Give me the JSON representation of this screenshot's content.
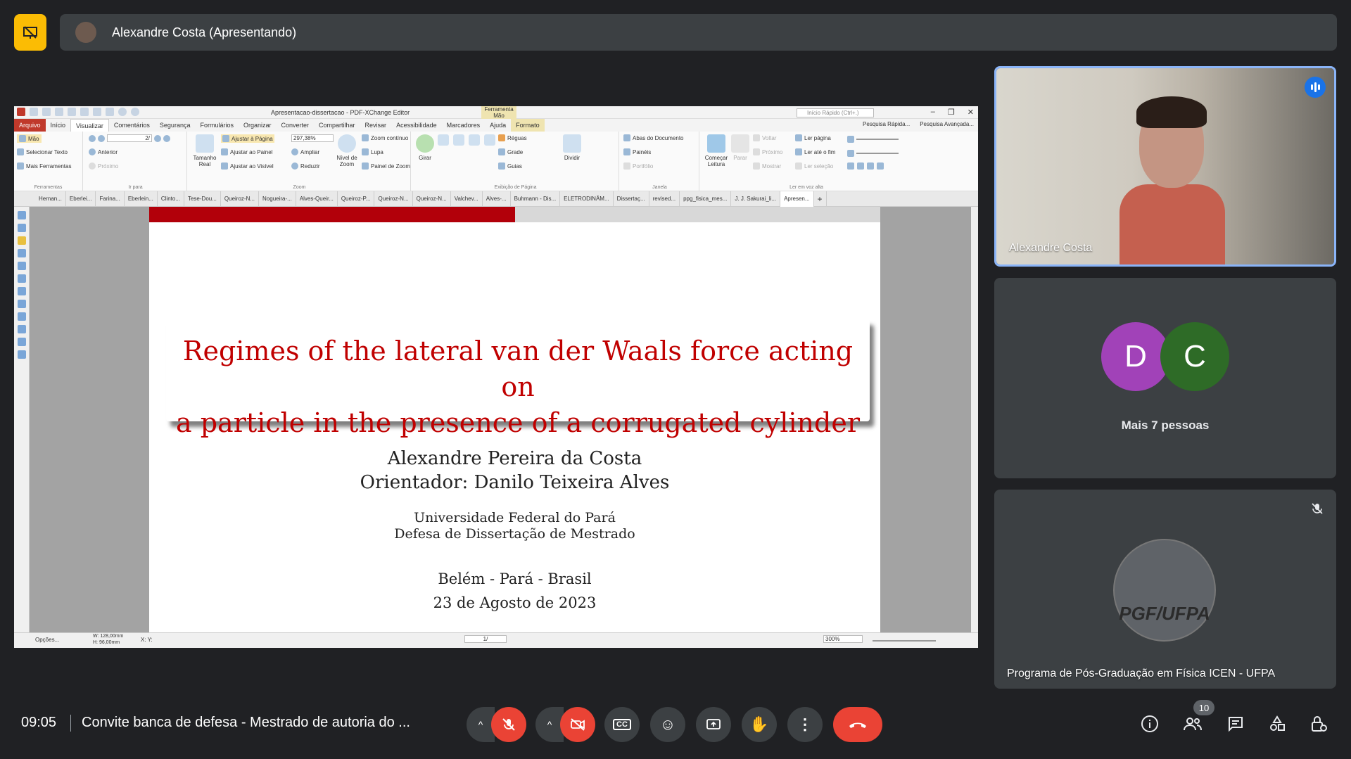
{
  "presenter": {
    "label": "Alexandre Costa (Apresentando)"
  },
  "pdf_app": {
    "window_title": "Apresentacao-dissertacao - PDF-XChange Editor",
    "quick_search_placeholder": "Início Rápido (Ctrl+.)",
    "context_tab": "Ferramenta Mão",
    "menu": [
      "Arquivo",
      "Início",
      "Visualizar",
      "Comentários",
      "Segurança",
      "Formulários",
      "Organizar",
      "Converter",
      "Compartilhar",
      "Revisar",
      "Acessibilidade",
      "Marcadores",
      "Ajuda",
      "Formato"
    ],
    "ribbon_right": [
      "Pesquisa Rápida...",
      "Pesquisa Avançada..."
    ],
    "ribbon_groups": {
      "ferramentas": {
        "label": "Ferramentas",
        "items": [
          "Mão",
          "Selecionar Texto",
          "Mais Ferramentas"
        ]
      },
      "ir_para": {
        "label": "Ir para",
        "page_field": "2/",
        "items": [
          "Anterior",
          "Próximo"
        ]
      },
      "zoom": {
        "label": "Zoom",
        "zoom_value": "297,38%",
        "big": "Tamanho Real",
        "items": [
          "Ajustar à Página",
          "Ajustar ao Painel",
          "Ajustar ao Visível",
          "Ampliar",
          "Reduzir"
        ],
        "nivel": "Nível de Zoom",
        "items2": [
          "Zoom contínuo",
          "Lupa",
          "Painel de Zoom"
        ]
      },
      "exibicao": {
        "label": "Exibição de Página",
        "girar": "Girar",
        "items": [
          "Réguas",
          "Grade",
          "Guias"
        ],
        "dividir": "Dividir"
      },
      "janela": {
        "label": "Janela",
        "items": [
          "Abas do Documento",
          "Painéis",
          "Portfólio"
        ]
      },
      "ler": {
        "label": "Ler em voz alta",
        "comecar": "Começar Leitura",
        "parar": "Parar",
        "items": [
          "Voltar",
          "Próximo",
          "Mostrar"
        ],
        "items2": [
          "Ler página",
          "Ler até o fim",
          "Ler seleção"
        ]
      }
    },
    "doc_tabs": [
      "Hernan...",
      "Eberlei...",
      "Farina...",
      "Eberlein...",
      "Clinto...",
      "Tese-Dou...",
      "Queiroz-N...",
      "Nogueira-...",
      "Alves-Queir...",
      "Queiroz-P...",
      "Queiroz-N...",
      "Queiroz-N...",
      "Valchev...",
      "Alves-...",
      "Buhmann - Dis...",
      "ELETRODINÂM...",
      "Dissertaç...",
      "revised...",
      "ppg_fisica_mes...",
      "J. J. Sakurai_li...",
      "Apresen..."
    ],
    "slide": {
      "title_line1": "Regimes of the lateral van der Waals force acting on",
      "title_line2": "a particle in the presence of a corrugated cylinder",
      "author": "Alexandre Pereira da Costa",
      "advisor": "Orientador: Danilo Teixeira Alves",
      "university": "Universidade Federal do Pará",
      "defense": "Defesa de Dissertação de Mestrado",
      "place": "Belém - Pará - Brasil",
      "date": "23 de Agosto de 2023"
    },
    "status": {
      "options": "Opções...",
      "width": "W: 128,00mm",
      "height": "H: 96,00mm",
      "xy": "X: Y:",
      "page": "1/",
      "zoom": "300%"
    }
  },
  "participants": {
    "main_name": "Alexandre Costa",
    "more_label": "Mais 7 pessoas",
    "avatars": [
      {
        "letter": "D",
        "color": "#a142b8"
      },
      {
        "letter": "C",
        "color": "#2e6b27"
      }
    ],
    "program_name": "Programa de Pós-Graduação em Física ICEN - UFPA",
    "logo_text": "PGF/UFPA"
  },
  "bottom_bar": {
    "time": "09:05",
    "meeting_title": "Convite banca de defesa - Mestrado de autoria do ...",
    "participant_count": "10"
  },
  "colors": {
    "accent_blue": "#8ab4f8",
    "red": "#ea4335",
    "present_yellow": "#fbbc04",
    "slide_red": "#c00000"
  }
}
